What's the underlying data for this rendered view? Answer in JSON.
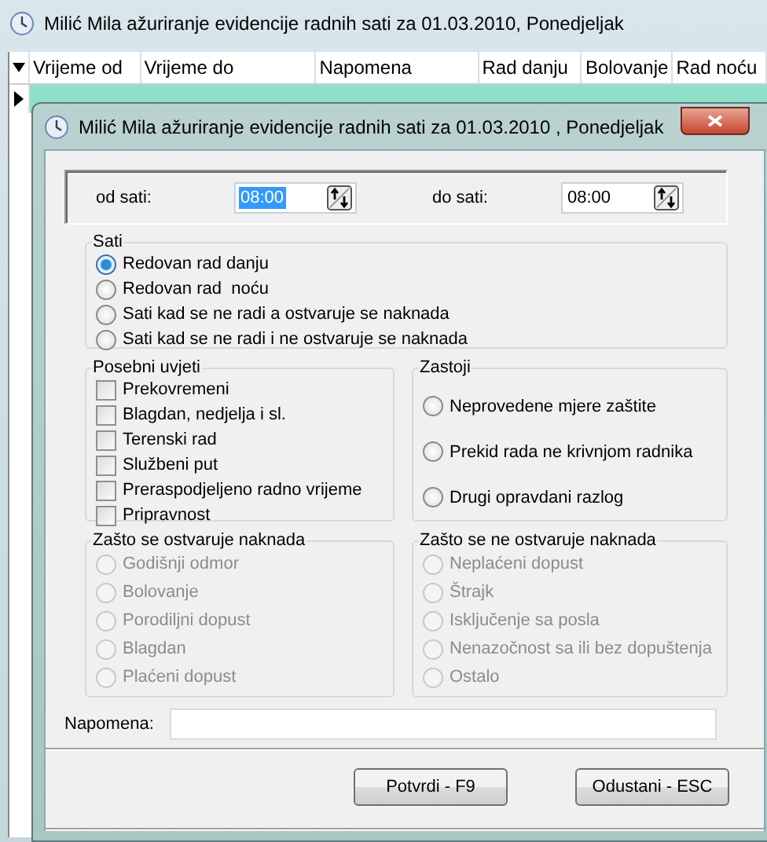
{
  "background_window": {
    "title": "Milić Mila ažuriranje evidencije radnih sati za 01.03.2010, Ponedjeljak",
    "table": {
      "columns": [
        "Vrijeme od",
        "Vrijeme do",
        "Napomena",
        "Rad danju",
        "Bolovanje",
        "Rad noću"
      ],
      "rows": [
        {
          "selected": true
        }
      ]
    }
  },
  "dialog": {
    "title": "Milić Mila ažuriranje evidencije radnih sati za 01.03.2010 , Ponedjeljak",
    "time": {
      "from_label": "od sati:",
      "from_value": "08:00",
      "from_focused": true,
      "to_label": "do sati:",
      "to_value": "08:00",
      "to_focused": false
    },
    "sati": {
      "title": "Sati",
      "disabled": false,
      "items": [
        {
          "label": "Redovan rad danju",
          "selected": true
        },
        {
          "label": "Redovan rad  noću",
          "selected": false
        },
        {
          "label": "Sati kad se ne radi a ostvaruje se naknada",
          "selected": false
        },
        {
          "label": "Sati kad se ne radi i ne ostvaruje se naknada",
          "selected": false
        }
      ]
    },
    "posebni_uvjeti": {
      "title": "Posebni uvjeti",
      "items": [
        {
          "label": "Prekovremeni",
          "checked": false
        },
        {
          "label": "Blagdan, nedjelja i sl.",
          "checked": false
        },
        {
          "label": "Terenski rad",
          "checked": false
        },
        {
          "label": "Službeni put",
          "checked": false
        },
        {
          "label": "Preraspodjeljeno radno vrijeme",
          "checked": false
        },
        {
          "label": "Pripravnost",
          "checked": false
        }
      ]
    },
    "zastoji": {
      "title": "Zastoji",
      "disabled": false,
      "items": [
        {
          "label": "Neprovedene mjere zaštite",
          "selected": false
        },
        {
          "label": "Prekid rada ne krivnjom radnika",
          "selected": false
        },
        {
          "label": "Drugi opravdani razlog",
          "selected": false
        }
      ]
    },
    "ostvaruje": {
      "title": "Zašto se ostvaruje naknada",
      "disabled": true,
      "items": [
        {
          "label": "Godišnji odmor",
          "selected": false
        },
        {
          "label": "Bolovanje",
          "selected": false
        },
        {
          "label": "Porodiljni dopust",
          "selected": false
        },
        {
          "label": "Blagdan",
          "selected": false
        },
        {
          "label": "Plaćeni dopust",
          "selected": false
        }
      ]
    },
    "ne_ostvaruje": {
      "title": "Zašto se ne ostvaruje naknada",
      "disabled": true,
      "items": [
        {
          "label": "Neplaćeni dopust",
          "selected": false
        },
        {
          "label": "Štrajk",
          "selected": false
        },
        {
          "label": "Isključenje sa posla",
          "selected": false
        },
        {
          "label": "Nenazočnost sa ili bez dopuštenja",
          "selected": false
        },
        {
          "label": "Ostalo",
          "selected": false
        }
      ]
    },
    "note": {
      "label": "Napomena:"
    },
    "buttons": [
      "Potvrdi - F9",
      "Odustani - ESC"
    ]
  }
}
